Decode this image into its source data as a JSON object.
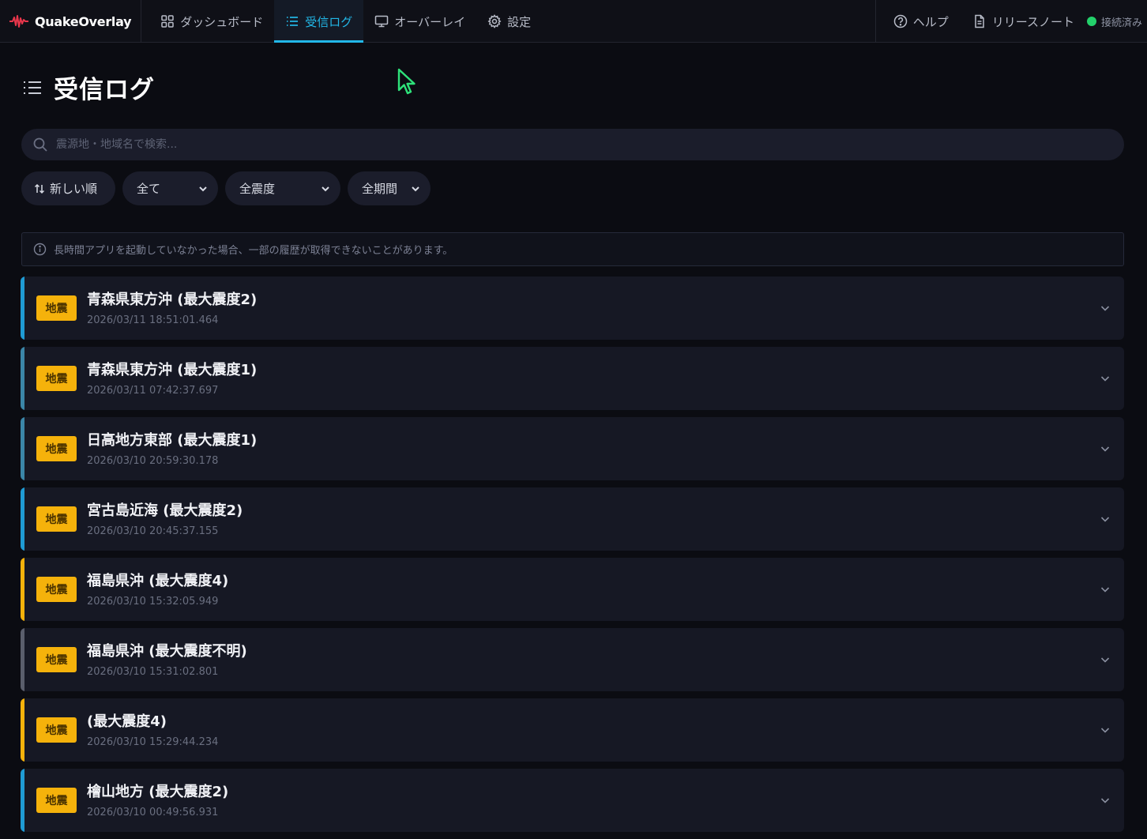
{
  "app": {
    "name": "QuakeOverlay",
    "accent": "#22b8e8",
    "logo_color": "#e8364b"
  },
  "nav": {
    "items": [
      {
        "label": "ダッシュボード",
        "icon": "dashboard-icon"
      },
      {
        "label": "受信ログ",
        "icon": "list-icon",
        "active": true
      },
      {
        "label": "オーバーレイ",
        "icon": "monitor-icon"
      },
      {
        "label": "設定",
        "icon": "gear-icon"
      }
    ],
    "help_label": "ヘルプ",
    "release_notes_label": "リリースノート",
    "status_label": "接続済み",
    "status_color": "#23d16b"
  },
  "page": {
    "title": "受信ログ"
  },
  "search": {
    "placeholder": "震源地・地域名で検索..."
  },
  "filters": {
    "sort_label": "新しい順",
    "type_selected": "全て",
    "intensity_selected": "全震度",
    "period_selected": "全期間"
  },
  "notice": {
    "text": "長時間アプリを起動していなかった場合、一部の履歴が取得できないことがあります。"
  },
  "logs": [
    {
      "badge": "地震",
      "title": "青森県東方沖 (最大震度2)",
      "time": "2026/03/11 18:51:01.464",
      "color": "#1f9bd4"
    },
    {
      "badge": "地震",
      "title": "青森県東方沖 (最大震度1)",
      "time": "2026/03/11 07:42:37.697",
      "color": "#3b86a8"
    },
    {
      "badge": "地震",
      "title": "日高地方東部 (最大震度1)",
      "time": "2026/03/10 20:59:30.178",
      "color": "#3b86a8"
    },
    {
      "badge": "地震",
      "title": "宮古島近海 (最大震度2)",
      "time": "2026/03/10 20:45:37.155",
      "color": "#1f9bd4"
    },
    {
      "badge": "地震",
      "title": "福島県沖 (最大震度4)",
      "time": "2026/03/10 15:32:05.949",
      "color": "#f5b20b"
    },
    {
      "badge": "地震",
      "title": "福島県沖 (最大震度不明)",
      "time": "2026/03/10 15:31:02.801",
      "color": "#5a5e6c"
    },
    {
      "badge": "地震",
      "title": "(最大震度4)",
      "time": "2026/03/10 15:29:44.234",
      "color": "#f5b20b"
    },
    {
      "badge": "地震",
      "title": "檜山地方 (最大震度2)",
      "time": "2026/03/10 00:49:56.931",
      "color": "#1f9bd4"
    }
  ]
}
